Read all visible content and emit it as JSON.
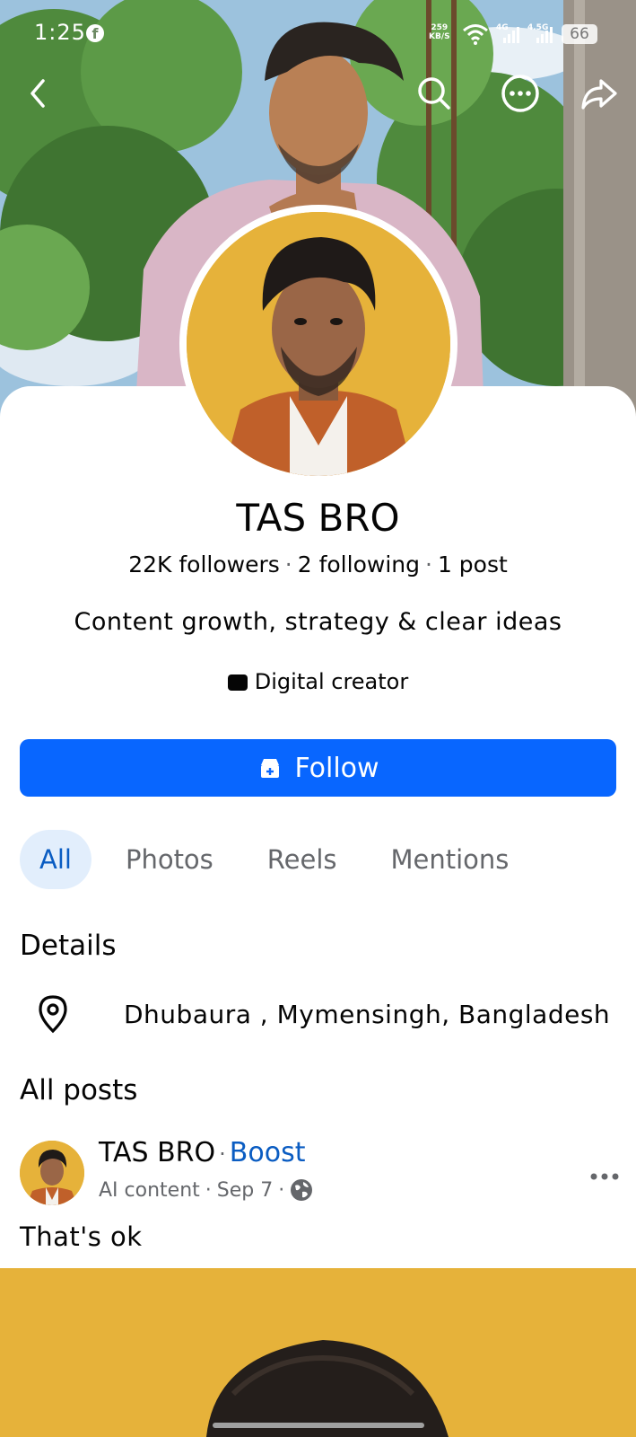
{
  "status_bar": {
    "time": "1:25",
    "app_icon": "facebook-icon",
    "net_speed_value": "259",
    "net_speed_unit": "KB/S",
    "network_1": "4G",
    "network_2": "4.5G",
    "battery": "66"
  },
  "nav": {
    "back_icon": "back-arrow-icon",
    "search_icon": "search-icon",
    "more_icon": "more-options-icon",
    "share_icon": "share-icon"
  },
  "profile": {
    "name": "TAS BRO",
    "followers": "22K followers",
    "following": "2 following",
    "posts": "1 post",
    "bio": "Content growth, strategy & clear ideas",
    "category": "Digital creator"
  },
  "follow_button": {
    "label": "Follow"
  },
  "tabs": [
    {
      "label": "All",
      "active": true
    },
    {
      "label": "Photos",
      "active": false
    },
    {
      "label": "Reels",
      "active": false
    },
    {
      "label": "Mentions",
      "active": false
    }
  ],
  "details": {
    "title": "Details",
    "location": "Dhubaura , Mymensingh, Bangladesh"
  },
  "posts": {
    "title": "All posts",
    "items": [
      {
        "author": "TAS BRO",
        "boost_label": "Boost",
        "meta_label": "AI content",
        "date": "Sep 7",
        "privacy_icon": "globe-icon",
        "text": "That's ok"
      }
    ]
  },
  "colors": {
    "primary_blue": "#0866ff",
    "link_blue": "#0a5cc2",
    "active_tab_bg": "#e2eefc",
    "avatar_bg": "#e6b23a",
    "secondary_text": "#65676b"
  }
}
